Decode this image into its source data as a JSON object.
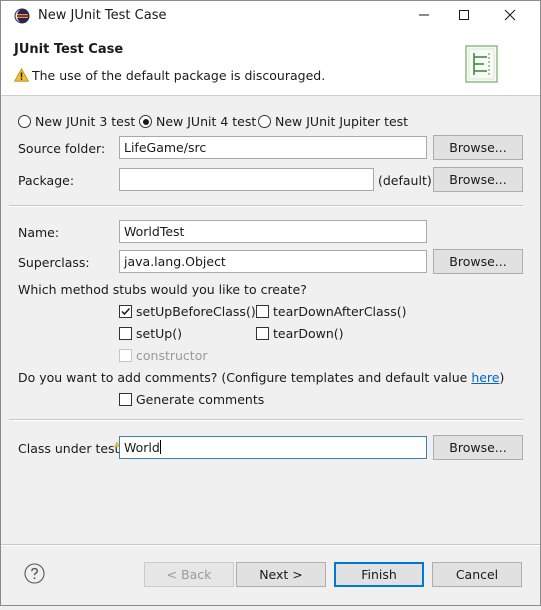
{
  "window": {
    "title": "New JUnit Test Case",
    "minimize_icon": "minimize-icon",
    "maximize_icon": "maximize-icon",
    "close_icon": "close-icon"
  },
  "header": {
    "title": "JUnit Test Case",
    "message": "The use of the default package is discouraged.",
    "message_icon": "warning-icon",
    "banner_icon": "junit-wizard-icon"
  },
  "junit_version": {
    "options": [
      "New JUnit 3 test",
      "New JUnit 4 test",
      "New JUnit Jupiter test"
    ],
    "selected": "New JUnit 4 test"
  },
  "source_folder": {
    "label": "Source folder:",
    "value": "LifeGame/src",
    "browse": "Browse..."
  },
  "package": {
    "label": "Package:",
    "value": "",
    "hint": "(default)",
    "browse": "Browse..."
  },
  "name": {
    "label": "Name:",
    "value": "WorldTest"
  },
  "superclass": {
    "label": "Superclass:",
    "value": "java.lang.Object",
    "browse": "Browse..."
  },
  "stubs": {
    "question": "Which method stubs would you like to create?",
    "setUpBeforeClass": {
      "label": "setUpBeforeClass()",
      "checked": true
    },
    "tearDownAfterClass": {
      "label": "tearDownAfterClass()",
      "checked": false
    },
    "setUp": {
      "label": "setUp()",
      "checked": false
    },
    "tearDown": {
      "label": "tearDown()",
      "checked": false
    },
    "constructor": {
      "label": "constructor",
      "checked": false,
      "enabled": false
    }
  },
  "comments": {
    "question_prefix": "Do you want to add comments? (Configure templates and default value ",
    "link": "here",
    "question_suffix": ")",
    "generate": {
      "label": "Generate comments",
      "checked": false
    }
  },
  "class_under_test": {
    "label": "Class under test:",
    "value": "World",
    "browse": "Browse..."
  },
  "footer": {
    "help_icon": "help-icon",
    "back": "< Back",
    "next": "Next >",
    "finish": "Finish",
    "cancel": "Cancel"
  },
  "colors": {
    "accent": "#0078d7",
    "link": "#0066cc",
    "warning": "#f2c12e"
  }
}
